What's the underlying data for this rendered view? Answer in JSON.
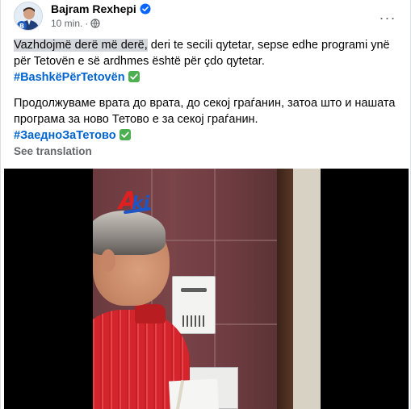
{
  "post": {
    "author": {
      "name": "Bajram Rexhepi",
      "verified_icon": "verified-badge-icon",
      "avatar_icon": "profile-avatar"
    },
    "meta": {
      "time": "10 min.",
      "separator": "·",
      "audience_icon": "globe-icon"
    },
    "more_icon": "more-options-icon",
    "more_label": "···",
    "text": {
      "p1_highlight": "Vazhdojmë derë më derë,",
      "p1_rest": " deri te secili qytetar, sepse edhe programi ynë për Tetovën e së ardhmes është për çdo qytetar.",
      "hashtag1": "#BashkëPërTetovën",
      "p2": "Продолжуваме врата до врата, до секој граѓанин, затоа што и нашата програма за ново Тетово е за секој граѓанин.",
      "hashtag2": "#ЗаедноЗаТетово",
      "check_icon": "check-mark-icon"
    },
    "see_translation": "See translation",
    "video": {
      "watermark_a": "A",
      "watermark_ki": "ki",
      "watermark_icon": "aki-logo"
    }
  },
  "colors": {
    "hashtag": "#0064d1",
    "muted": "#65676b",
    "verified": "#0866ff",
    "check": "#4caf50",
    "highlight": "#d3d6db"
  }
}
